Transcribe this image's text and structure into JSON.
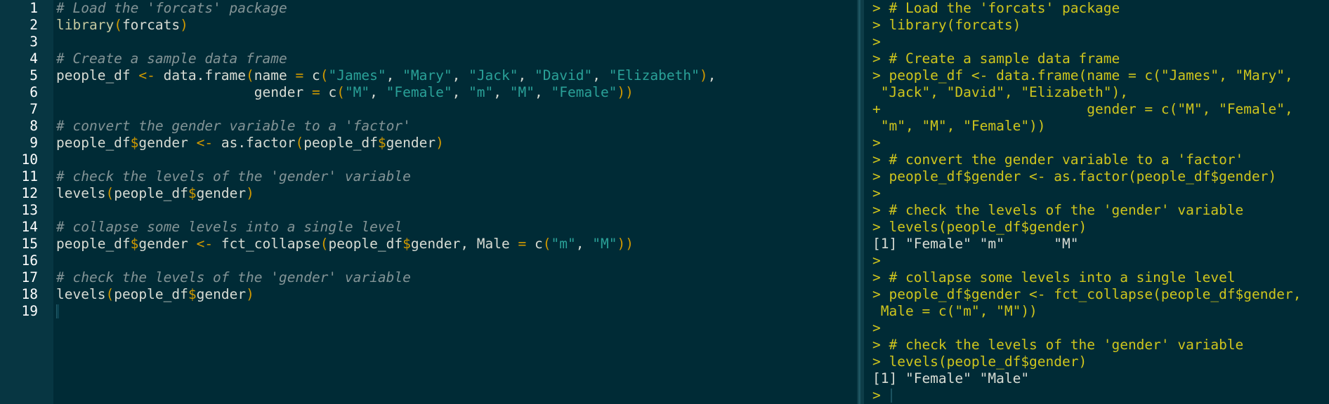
{
  "editor": {
    "line_numbers": [
      "1",
      "2",
      "3",
      "4",
      "5",
      "6",
      "7",
      "8",
      "9",
      "10",
      "11",
      "12",
      "13",
      "14",
      "15",
      "16",
      "17",
      "18",
      "19"
    ],
    "lines": [
      [
        {
          "t": "cm",
          "s": "# Load the 'forcats' package"
        }
      ],
      [
        {
          "t": "fn",
          "s": "library"
        },
        {
          "t": "par",
          "s": "("
        },
        {
          "t": "id",
          "s": "forcats"
        },
        {
          "t": "par",
          "s": ")"
        }
      ],
      [],
      [
        {
          "t": "cm",
          "s": "# Create a sample data frame"
        }
      ],
      [
        {
          "t": "id",
          "s": "people_df "
        },
        {
          "t": "op",
          "s": "<-"
        },
        {
          "t": "id",
          "s": " data.frame"
        },
        {
          "t": "par",
          "s": "("
        },
        {
          "t": "id",
          "s": "name "
        },
        {
          "t": "op",
          "s": "="
        },
        {
          "t": "id",
          "s": " c"
        },
        {
          "t": "par",
          "s": "("
        },
        {
          "t": "str",
          "s": "\"James\""
        },
        {
          "t": "id",
          "s": ", "
        },
        {
          "t": "str",
          "s": "\"Mary\""
        },
        {
          "t": "id",
          "s": ", "
        },
        {
          "t": "str",
          "s": "\"Jack\""
        },
        {
          "t": "id",
          "s": ", "
        },
        {
          "t": "str",
          "s": "\"David\""
        },
        {
          "t": "id",
          "s": ", "
        },
        {
          "t": "str",
          "s": "\"Elizabeth\""
        },
        {
          "t": "par",
          "s": ")"
        },
        {
          "t": "id",
          "s": ","
        }
      ],
      [
        {
          "t": "id",
          "s": "                        gender "
        },
        {
          "t": "op",
          "s": "="
        },
        {
          "t": "id",
          "s": " c"
        },
        {
          "t": "par",
          "s": "("
        },
        {
          "t": "str",
          "s": "\"M\""
        },
        {
          "t": "id",
          "s": ", "
        },
        {
          "t": "str",
          "s": "\"Female\""
        },
        {
          "t": "id",
          "s": ", "
        },
        {
          "t": "str",
          "s": "\"m\""
        },
        {
          "t": "id",
          "s": ", "
        },
        {
          "t": "str",
          "s": "\"M\""
        },
        {
          "t": "id",
          "s": ", "
        },
        {
          "t": "str",
          "s": "\"Female\""
        },
        {
          "t": "par",
          "s": "))"
        }
      ],
      [],
      [
        {
          "t": "cm",
          "s": "# convert the gender variable to a 'factor'"
        }
      ],
      [
        {
          "t": "id",
          "s": "people_df"
        },
        {
          "t": "dol",
          "s": "$"
        },
        {
          "t": "id",
          "s": "gender "
        },
        {
          "t": "op",
          "s": "<-"
        },
        {
          "t": "id",
          "s": " as.factor"
        },
        {
          "t": "par",
          "s": "("
        },
        {
          "t": "id",
          "s": "people_df"
        },
        {
          "t": "dol",
          "s": "$"
        },
        {
          "t": "id",
          "s": "gender"
        },
        {
          "t": "par",
          "s": ")"
        }
      ],
      [],
      [
        {
          "t": "cm",
          "s": "# check the levels of the 'gender' variable"
        }
      ],
      [
        {
          "t": "id",
          "s": "levels"
        },
        {
          "t": "par",
          "s": "("
        },
        {
          "t": "id",
          "s": "people_df"
        },
        {
          "t": "dol",
          "s": "$"
        },
        {
          "t": "id",
          "s": "gender"
        },
        {
          "t": "par",
          "s": ")"
        }
      ],
      [],
      [
        {
          "t": "cm",
          "s": "# collapse some levels into a single level"
        }
      ],
      [
        {
          "t": "id",
          "s": "people_df"
        },
        {
          "t": "dol",
          "s": "$"
        },
        {
          "t": "id",
          "s": "gender "
        },
        {
          "t": "op",
          "s": "<-"
        },
        {
          "t": "id",
          "s": " fct_collapse"
        },
        {
          "t": "par",
          "s": "("
        },
        {
          "t": "id",
          "s": "people_df"
        },
        {
          "t": "dol",
          "s": "$"
        },
        {
          "t": "id",
          "s": "gender, Male "
        },
        {
          "t": "op",
          "s": "="
        },
        {
          "t": "id",
          "s": " c"
        },
        {
          "t": "par",
          "s": "("
        },
        {
          "t": "str",
          "s": "\"m\""
        },
        {
          "t": "id",
          "s": ", "
        },
        {
          "t": "str",
          "s": "\"M\""
        },
        {
          "t": "par",
          "s": "))"
        }
      ],
      [],
      [
        {
          "t": "cm",
          "s": "# check the levels of the 'gender' variable"
        }
      ],
      [
        {
          "t": "id",
          "s": "levels"
        },
        {
          "t": "par",
          "s": "("
        },
        {
          "t": "id",
          "s": "people_df"
        },
        {
          "t": "dol",
          "s": "$"
        },
        {
          "t": "id",
          "s": "gender"
        },
        {
          "t": "par",
          "s": ")"
        }
      ],
      []
    ]
  },
  "console": {
    "lines": [
      {
        "t": "echo",
        "s": "> # Load the 'forcats' package"
      },
      {
        "t": "echo",
        "s": "> library(forcats)"
      },
      {
        "t": "echo",
        "s": ">"
      },
      {
        "t": "echo",
        "s": "> # Create a sample data frame"
      },
      {
        "t": "echo",
        "s": "> people_df <- data.frame(name = c(\"James\", \"Mary\","
      },
      {
        "t": "echo",
        "s": " \"Jack\", \"David\", \"Elizabeth\"),"
      },
      {
        "t": "echo",
        "s": "+                         gender = c(\"M\", \"Female\","
      },
      {
        "t": "echo",
        "s": " \"m\", \"M\", \"Female\"))"
      },
      {
        "t": "echo",
        "s": ">"
      },
      {
        "t": "echo",
        "s": "> # convert the gender variable to a 'factor'"
      },
      {
        "t": "echo",
        "s": "> people_df$gender <- as.factor(people_df$gender)"
      },
      {
        "t": "echo",
        "s": ">"
      },
      {
        "t": "echo",
        "s": "> # check the levels of the 'gender' variable"
      },
      {
        "t": "echo",
        "s": "> levels(people_df$gender)"
      },
      {
        "t": "outp",
        "s": "[1] \"Female\" \"m\"      \"M\""
      },
      {
        "t": "echo",
        "s": ">"
      },
      {
        "t": "echo",
        "s": "> # collapse some levels into a single level"
      },
      {
        "t": "echo",
        "s": "> people_df$gender <- fct_collapse(people_df$gender,"
      },
      {
        "t": "echo",
        "s": " Male = c(\"m\", \"M\"))"
      },
      {
        "t": "echo",
        "s": ">"
      },
      {
        "t": "echo",
        "s": "> # check the levels of the 'gender' variable"
      },
      {
        "t": "echo",
        "s": "> levels(people_df$gender)"
      },
      {
        "t": "outp",
        "s": "[1] \"Female\" \"Male\""
      },
      {
        "t": "echo",
        "s": ">"
      }
    ]
  },
  "colors": {
    "background": "#002b36",
    "gutter": "#073642",
    "comment": "#839496",
    "string": "#2aa198",
    "operator": "#d19a00",
    "console_echo": "#cfc51d"
  }
}
